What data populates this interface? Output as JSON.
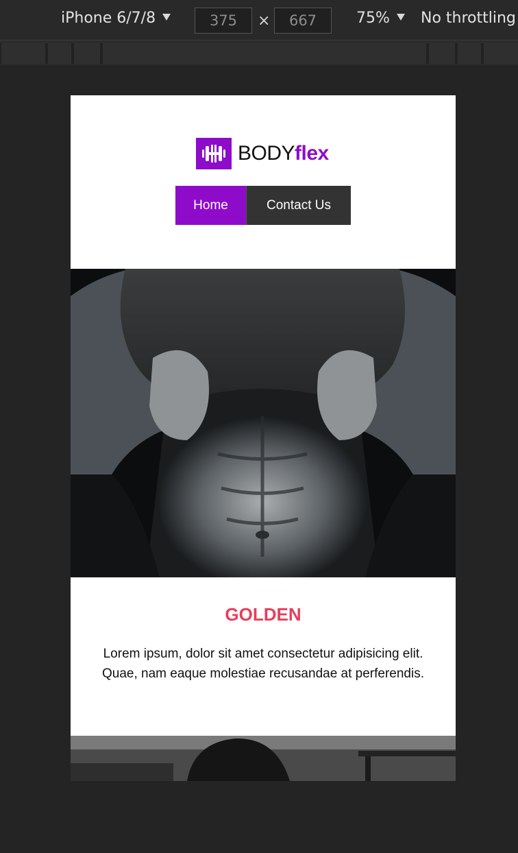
{
  "devtools": {
    "device_label": "iPhone 6/7/8",
    "width_value": "375",
    "height_value": "667",
    "times_symbol": "×",
    "zoom_label": "75%",
    "throttling_label": "No throttling"
  },
  "site": {
    "logo": {
      "text_main": "BODY",
      "text_accent": "flex",
      "icon": "dumbbell-icon"
    },
    "nav": {
      "home_label": "Home",
      "contact_label": "Contact Us"
    },
    "section": {
      "title": "GOLDEN",
      "body": "Lorem ipsum, dolor sit amet consectetur adipisicing elit. Quae, nam eaque molestiae recusandae at perferendis."
    }
  },
  "colors": {
    "brand_purple": "#8e0cc9",
    "title_pink": "#e83e5c",
    "nav_dark": "#333333",
    "devtools_bg": "#242424"
  }
}
